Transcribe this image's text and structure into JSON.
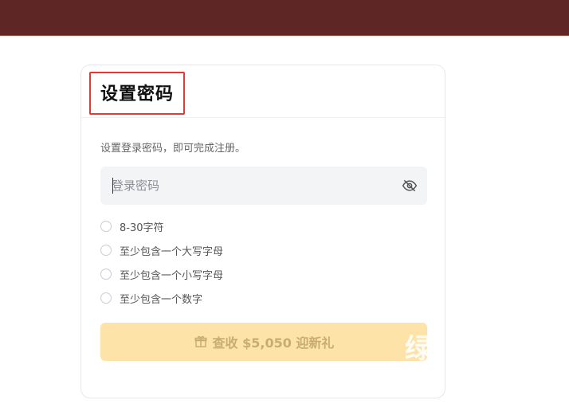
{
  "header": {
    "color": "#5e2624"
  },
  "card": {
    "title": "设置密码",
    "subtitle": "设置登录密码，即可完成注册。",
    "password": {
      "placeholder": "登录密码",
      "value": ""
    },
    "rules": [
      {
        "label": "8-30字符",
        "checked": false
      },
      {
        "label": "至少包含一个大写字母",
        "checked": false
      },
      {
        "label": "至少包含一个小写字母",
        "checked": false
      },
      {
        "label": "至少包含一个数字",
        "checked": false
      }
    ],
    "submit": {
      "label": "查收 $5,050 迎新礼",
      "icon": "gift-icon",
      "disabled": true
    }
  },
  "overlay": {
    "watermark": "绿"
  },
  "colors": {
    "accent_disabled": "#fde3a7",
    "highlight_border": "#e53935"
  }
}
